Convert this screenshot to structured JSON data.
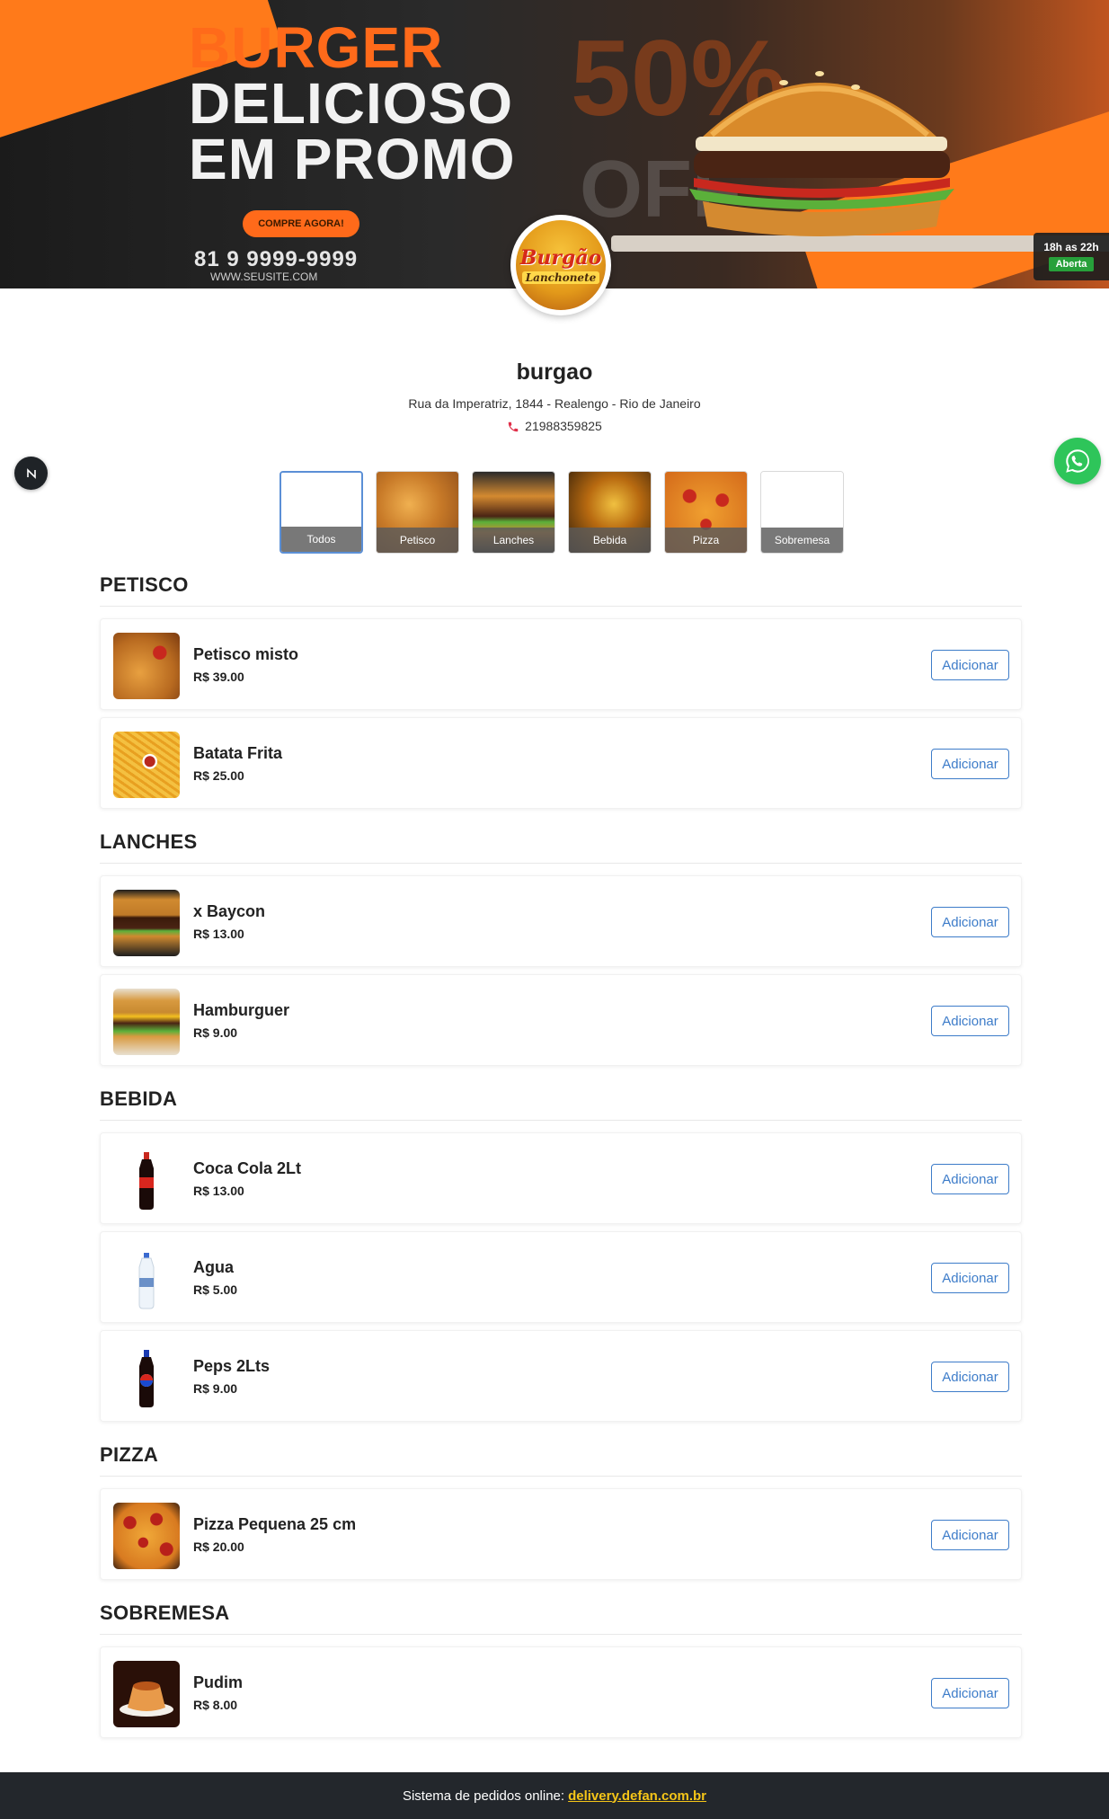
{
  "banner": {
    "headline_1": "BURGER",
    "headline_2": "DELICIOSO",
    "headline_3": "EM PROMO",
    "promo_button": "COMPRE AGORA!",
    "promo_phone": "81 9 9999-9999",
    "promo_site": "WWW.SEUSITE.COM",
    "bg_percent": "50%",
    "bg_off": "OFF"
  },
  "hours": {
    "text": "18h as 22h",
    "status": "Aberta",
    "status_color": "#27a03a"
  },
  "logo": {
    "name": "Burgão",
    "sub": "Lanchonete"
  },
  "store": {
    "name": "burgao",
    "address": "Rua da Imperatriz, 1844 - Realengo - Rio de Janeiro",
    "phone": "21988359825"
  },
  "categories": [
    {
      "label": "Todos",
      "active": true
    },
    {
      "label": "Petisco"
    },
    {
      "label": "Lanches"
    },
    {
      "label": "Bebida"
    },
    {
      "label": "Pizza"
    },
    {
      "label": "Sobremesa"
    }
  ],
  "add_label": "Adicionar",
  "sections": [
    {
      "title": "PETISCO",
      "items": [
        {
          "name": "Petisco misto",
          "price": "R$ 39.00",
          "thumb": "fried-food"
        },
        {
          "name": "Batata Frita",
          "price": "R$ 25.00",
          "thumb": "fries"
        }
      ]
    },
    {
      "title": "LANCHES",
      "items": [
        {
          "name": "x Baycon",
          "price": "R$ 13.00",
          "thumb": "burger-dark"
        },
        {
          "name": "Hamburguer",
          "price": "R$ 9.00",
          "thumb": "burger-cheese"
        }
      ]
    },
    {
      "title": "BEBIDA",
      "items": [
        {
          "name": "Coca Cola 2Lt",
          "price": "R$ 13.00",
          "thumb": "cola-bottle"
        },
        {
          "name": "Agua",
          "price": "R$ 5.00",
          "thumb": "water-bottle"
        },
        {
          "name": "Peps 2Lts",
          "price": "R$ 9.00",
          "thumb": "pepsi-bottle"
        }
      ]
    },
    {
      "title": "PIZZA",
      "items": [
        {
          "name": "Pizza Pequena 25 cm",
          "price": "R$ 20.00",
          "thumb": "pizza"
        }
      ]
    },
    {
      "title": "SOBREMESA",
      "items": [
        {
          "name": "Pudim",
          "price": "R$ 8.00",
          "thumb": "pudding"
        }
      ]
    }
  ],
  "footer": {
    "text": "Sistema de pedidos online:",
    "link": "delivery.defan.com.br",
    "link_color": "#f5c518"
  }
}
